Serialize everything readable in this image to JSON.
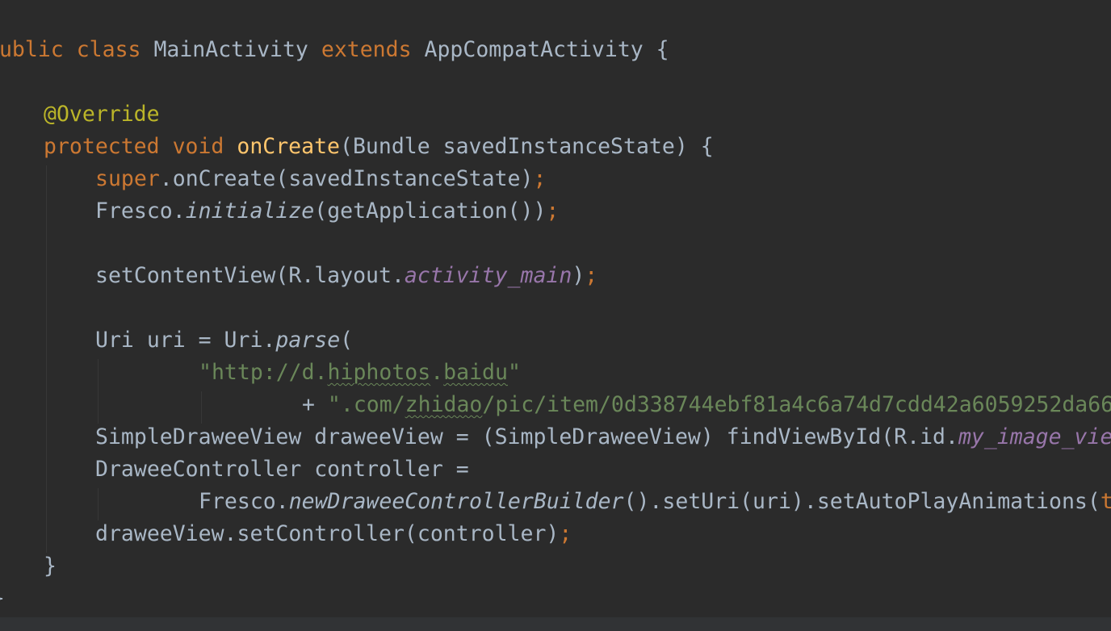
{
  "editor": {
    "lines": {
      "l1": {
        "a": "public",
        "b": " ",
        "c": "class",
        "d": " MainActivity ",
        "e": "extends",
        "f": " AppCompatActivity {"
      },
      "l3": {
        "a": "@Override"
      },
      "l4": {
        "a": "protected",
        "b": " ",
        "c": "void",
        "d": " ",
        "e": "onCreate",
        "f": "(Bundle savedInstanceState) {"
      },
      "l5": {
        "a": "super",
        "b": ".onCreate(savedInstanceState)",
        "c": ";"
      },
      "l6": {
        "a": "Fresco.",
        "b": "initialize",
        "c": "(getApplication())",
        "d": ";"
      },
      "l8": {
        "a": "setContentView(R.layout.",
        "b": "activity_main",
        "c": ")",
        "d": ";"
      },
      "l10": {
        "a": "Uri uri = Uri.",
        "b": "parse",
        "c": "("
      },
      "l11": {
        "a": "\"http://d.",
        "b": "hiphotos",
        "c": ".",
        "d": "baidu",
        "e": "\""
      },
      "l12": {
        "a": "+ ",
        "b": "\".com/",
        "c": "zhidao",
        "d": "/pic/item/0d338744ebf81a4c6a74d7cdd42a6059252da66"
      },
      "l13": {
        "a": "SimpleDraweeView draweeView = (SimpleDraweeView) findViewById(R.id.",
        "b": "my_image_vie"
      },
      "l14": {
        "a": "DraweeController controller ="
      },
      "l15": {
        "a": "Fresco.",
        "b": "newDraweeControllerBuilder",
        "c": "().setUri(uri).setAutoPlayAnimations(",
        "d": "t"
      },
      "l16": {
        "a": "draweeView.setController(controller)",
        "b": ";"
      },
      "l17": {
        "a": "}"
      },
      "l18": {
        "a": "}"
      }
    }
  },
  "colors": {
    "background": "#2b2b2b",
    "keyword": "#cc7832",
    "annotation": "#bbb529",
    "method_declaration": "#ffc66d",
    "string": "#6a8759",
    "field": "#9876aa",
    "default_text": "#a9b7c6"
  }
}
